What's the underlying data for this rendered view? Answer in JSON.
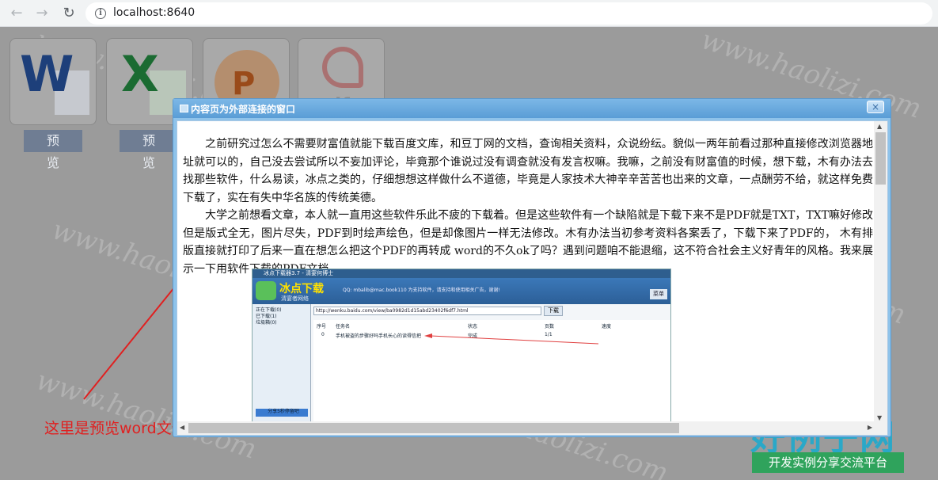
{
  "browser": {
    "url": "localhost:8640"
  },
  "icons": [
    {
      "name": "word-icon",
      "letter": "W"
    },
    {
      "name": "excel-icon",
      "letter": "X"
    },
    {
      "name": "powerpoint-icon",
      "letter": "P"
    },
    {
      "name": "pdf-icon",
      "letter": "pdf"
    }
  ],
  "preview_buttons": [
    "预 览",
    "预 览"
  ],
  "watermark": "www.haolizi.com",
  "dialog": {
    "title": "内容页为外部连接的窗口",
    "close_label": "×",
    "paragraph1": "之前研究过怎么不需要财富值就能下载百度文库，和豆丁网的文档，查询相关资料，众说纷纭。貌似一两年前看过那种直接修改浏览器地址就可以的，自己没去尝试所以不妄加评论，毕竟那个谁说过没有调查就没有发言权嘛。我嘛，之前没有财富值的时候，想下载，木有办法去找那些软件，什么易读，冰点之类的，仔细想想这样做什么不道德，毕竟是人家技术大神辛辛苦苦也出来的文章，一点酬劳不给，就这样免费下载了，实在有失中华名族的传统美德。",
    "paragraph2": "大学之前想看文章，本人就一直用这些软件乐此不疲的下载着。但是这些软件有一个缺陷就是下载下来不是PDF就是TXT，TXT嘛好修改但是版式全无，图片尽失，PDF到时绘声绘色，但是却像图片一样无法修改。木有办法当初参考资料各案丢了，下载下来了PDF的， 木有排版直接就打印了后来一直在想怎么把这个PDF的再转成 word的不久ok了吗？遇到问题咱不能退缩，这不符合社会主义好青年的风格。我来展示一下用软件下载的PDF文档"
  },
  "embedded_screenshot": {
    "title": "冰点下载器3.7 - 清宴何博士",
    "brand": "冰点下载",
    "brand_sub": "清宴者网络",
    "info": "QQ: mbalib@mac.book110 为支持软件，请支持和使用相关广告，谢谢!",
    "menu": "菜单",
    "url": "http://wenku.baidu.com/view/ba0982d1d15abd23402f6df7.html",
    "go_label": "下载",
    "sidebar": [
      "正在下载(0)",
      "已下载(1)",
      "垃圾箱(0)"
    ],
    "sidebar_caption": "分享5秒停留吧",
    "columns": [
      "序号",
      "任务名",
      "状态",
      "页数",
      "速度"
    ],
    "row": {
      "index": "0",
      "task": "手机被盗的步骤好吗手机长心的读得信把",
      "status": "完成",
      "pages": "1/1",
      "speed": ""
    }
  },
  "annotation": "这里是预览word文件的内容",
  "logo": {
    "main": "好例子网",
    "sub": "开发实例分享交流平台"
  },
  "colors": {
    "annotation": "#e02020",
    "dialog_header": "#5a9dd6",
    "preview_button": "#6f7d93"
  }
}
